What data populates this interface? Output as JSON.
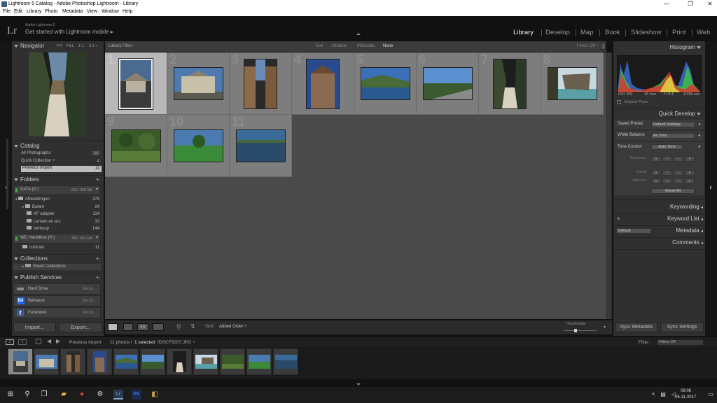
{
  "window": {
    "title": "Lightroom 5 Catalog - Adobe Photoshop Lightroom - Library",
    "controls": {
      "minimize": "—",
      "maximize": "❐",
      "close": "✕"
    }
  },
  "menu": [
    "File",
    "Edit",
    "Library",
    "Photo",
    "Metadata",
    "View",
    "Window",
    "Help"
  ],
  "identity": {
    "logo": "Lr",
    "subtitle": "Adobe Lightroom 5",
    "tagline": "Get started with Lightroom mobile ▸"
  },
  "modules": [
    {
      "label": "Library",
      "active": true
    },
    {
      "label": "Develop"
    },
    {
      "label": "Map"
    },
    {
      "label": "Book"
    },
    {
      "label": "Slideshow"
    },
    {
      "label": "Print"
    },
    {
      "label": "Web"
    }
  ],
  "navigator": {
    "title": "Navigator",
    "zoom": [
      "FIT",
      "FILL",
      "1:1",
      "3:1 ÷"
    ]
  },
  "catalog": {
    "title": "Catalog",
    "items": [
      {
        "label": "All Photographs",
        "count": "390"
      },
      {
        "label": "Quick Collection +",
        "count": "4"
      },
      {
        "label": "Previous Import",
        "count": "11"
      }
    ]
  },
  "folders": {
    "title": "Folders",
    "add": "+.",
    "drives": [
      {
        "label": "DATA (D:)",
        "size": "622 / 698 GB"
      },
      {
        "label": "WD Harddrive (H:)",
        "size": "396 / 931 GB"
      }
    ],
    "items": [
      {
        "label": "Afbeeldingen",
        "count": "379"
      },
      {
        "label": "Buiten",
        "count": "24"
      },
      {
        "label": "KF adapter",
        "count": "114"
      },
      {
        "label": "Lensen en acc",
        "count": "33"
      },
      {
        "label": "Verkoop",
        "count": "144"
      },
      {
        "label": "contrast",
        "count": "11"
      }
    ]
  },
  "collections": {
    "title": "Collections",
    "add": "+.",
    "items": [
      "Smart Collections"
    ]
  },
  "publish": {
    "title": "Publish Services",
    "add": "+.",
    "items": [
      {
        "label": "Hard Drive",
        "action": "Set Up..."
      },
      {
        "label": "Behance",
        "action": "Set Up..."
      },
      {
        "label": "Facebook",
        "action": "Set Up..."
      }
    ]
  },
  "left_buttons": {
    "import": "Import...",
    "export": "Export..."
  },
  "filterbar": {
    "title": "Library Filter :",
    "options": [
      "Text",
      "Attribute",
      "Metadata",
      "None"
    ],
    "filters": "Filters Off ÷"
  },
  "grid": {
    "numbers": [
      "1",
      "2",
      "3",
      "4",
      "5",
      "6",
      "7",
      "8",
      "9",
      "10",
      "11"
    ],
    "selected": "1"
  },
  "toolbar": {
    "sort_label": "Sort:",
    "sort_value": "Added Order ÷",
    "thumbnails": "Thumbnails"
  },
  "right": {
    "histogram": "Histogram",
    "exif": [
      "ISO 200",
      "16 mm",
      "f / 6.4",
      "1/250 sec"
    ],
    "original_photo": "Original Photo",
    "quick_develop": "Quick Develop",
    "saved_preset_label": "Saved Preset",
    "saved_preset_value": "Default Settings",
    "white_balance_label": "White Balance",
    "white_balance_value": "As Shot",
    "tone_control_label": "Tone Control",
    "auto_tone": "Auto Tone",
    "exposure": "Exposure",
    "clarity": "Clarity",
    "vibrance": "Vibrance",
    "reset_all": "Reset All",
    "keywording": "Keywording",
    "keyword_list": "Keyword List",
    "keyword_add": "+",
    "metadata": "Metadata",
    "metadata_preset": "Default",
    "comments": "Comments",
    "sync_metadata": "Sync Metadata",
    "sync_settings": "Sync Settings"
  },
  "filmstrip": {
    "source": "Previous Import",
    "info_prefix": "11 photos /",
    "info_selected": "1 selected",
    "info_file": "/DSCF5007.JPG ÷",
    "filter_label": "Filter :",
    "filter_value": "Filters Off"
  },
  "taskbar": {
    "time": "09:06",
    "date": "26-11-2017"
  },
  "colors": {
    "accent": "#3a5a80",
    "panel": "#303030",
    "grid": "#4a4a4a",
    "selected_cell": "#b8b8b8"
  }
}
